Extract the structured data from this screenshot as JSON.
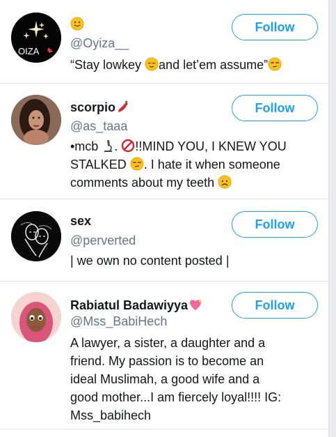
{
  "follow_label": "Follow",
  "users": [
    {
      "name": "🙂",
      "handle": "@Oyiza__",
      "bio_parts": [
        "“Stay lowkey ",
        "and let’em assume”"
      ],
      "avatar_text": "OIZA"
    },
    {
      "name": "scorpio",
      "handle": "@as_taaa",
      "bio_parts": [
        "•mcb ",
        ". ",
        "!!MIND YOU, I KNEW YOU",
        "STALKED ",
        ". I hate it when someone",
        "comments about my teeth "
      ]
    },
    {
      "name": "sex",
      "handle": "@perverted",
      "bio": "| we own no content posted |"
    },
    {
      "name": "Rabiatul Badawiyya",
      "handle": "@Mss_BabiHech",
      "bio_lines": [
        "A lawyer, a sister, a daughter and a",
        "friend. My passion is to become an",
        "ideal Muslimah, a good wife and a",
        "good mother...I am fiercely loyal!!!! IG:",
        "Mss_babihech"
      ]
    }
  ],
  "colors": {
    "accent": "#1da1f2",
    "handle": "#657786",
    "text": "#14171a"
  }
}
